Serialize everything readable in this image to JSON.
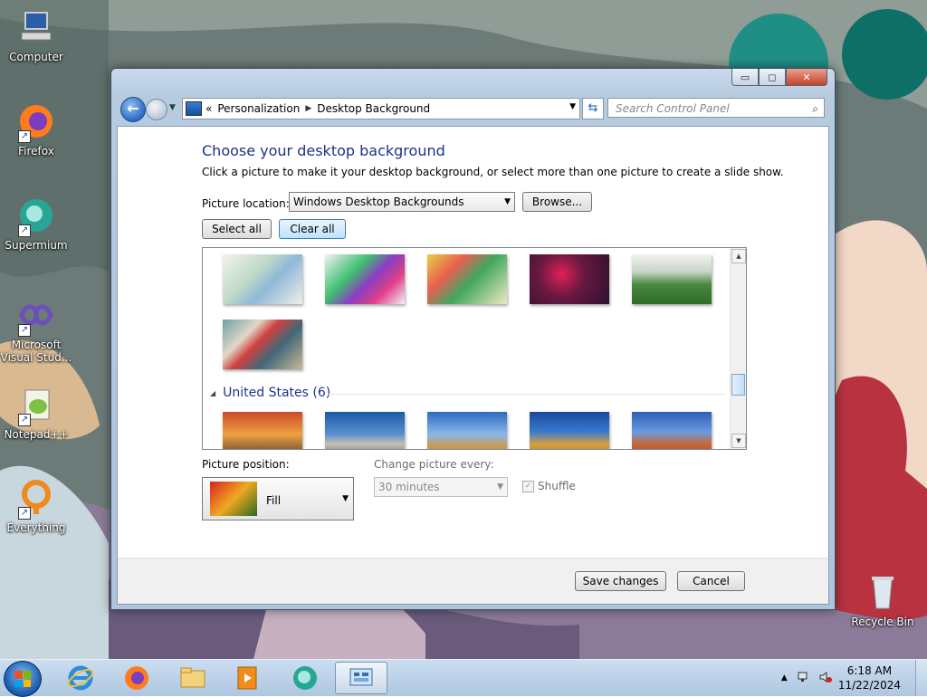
{
  "desktop": {
    "icons": [
      {
        "label": "Computer",
        "icon": "computer-icon"
      },
      {
        "label": "Firefox",
        "icon": "firefox-icon"
      },
      {
        "label": "Supermium",
        "icon": "supermium-icon"
      },
      {
        "label": "Microsoft Visual Stud...",
        "icon": "visual-studio-icon"
      },
      {
        "label": "Notepad++",
        "icon": "notepadpp-icon"
      },
      {
        "label": "Everything",
        "icon": "everything-icon"
      },
      {
        "label": "Recycle Bin",
        "icon": "recycle-bin-icon"
      }
    ]
  },
  "window": {
    "controls": {
      "minimize": "▭",
      "maximize": "◻",
      "close": "✕"
    },
    "nav": {
      "back": "←",
      "breadcrumb_prefix": "«",
      "breadcrumbs": [
        "Personalization",
        "Desktop Background"
      ],
      "search_placeholder": "Search Control Panel"
    },
    "heading": "Choose your desktop background",
    "description": "Click a picture to make it your desktop background, or select more than one picture to create a slide show.",
    "picture_location_label": "Picture location:",
    "picture_location_value": "Windows Desktop Backgrounds",
    "browse_button": "Browse...",
    "select_all_button": "Select all",
    "clear_all_button": "Clear all",
    "gallery": {
      "row1_thumbs": [
        "#cfe0c8",
        "#3fa06a",
        "#e7d24a",
        "#5a1d3d",
        "#6e9a5c"
      ],
      "row2_thumbs": [
        "#8aa3a0"
      ],
      "group_label": "United States (6)",
      "us_thumbs": [
        "#d2763a",
        "#2c66b0",
        "#3a77c8",
        "#c78a2c",
        "#2c5fb5"
      ]
    },
    "picture_position_label": "Picture position:",
    "picture_position_value": "Fill",
    "change_every_label": "Change picture every:",
    "change_every_value": "30 minutes",
    "shuffle_label": "Shuffle",
    "save_button": "Save changes",
    "cancel_button": "Cancel"
  },
  "taskbar": {
    "time": "6:18 AM",
    "date": "11/22/2024",
    "apps": [
      "internet-explorer-icon",
      "firefox-icon",
      "explorer-folder-icon",
      "media-player-icon",
      "supermium-icon",
      "control-panel-icon"
    ]
  }
}
